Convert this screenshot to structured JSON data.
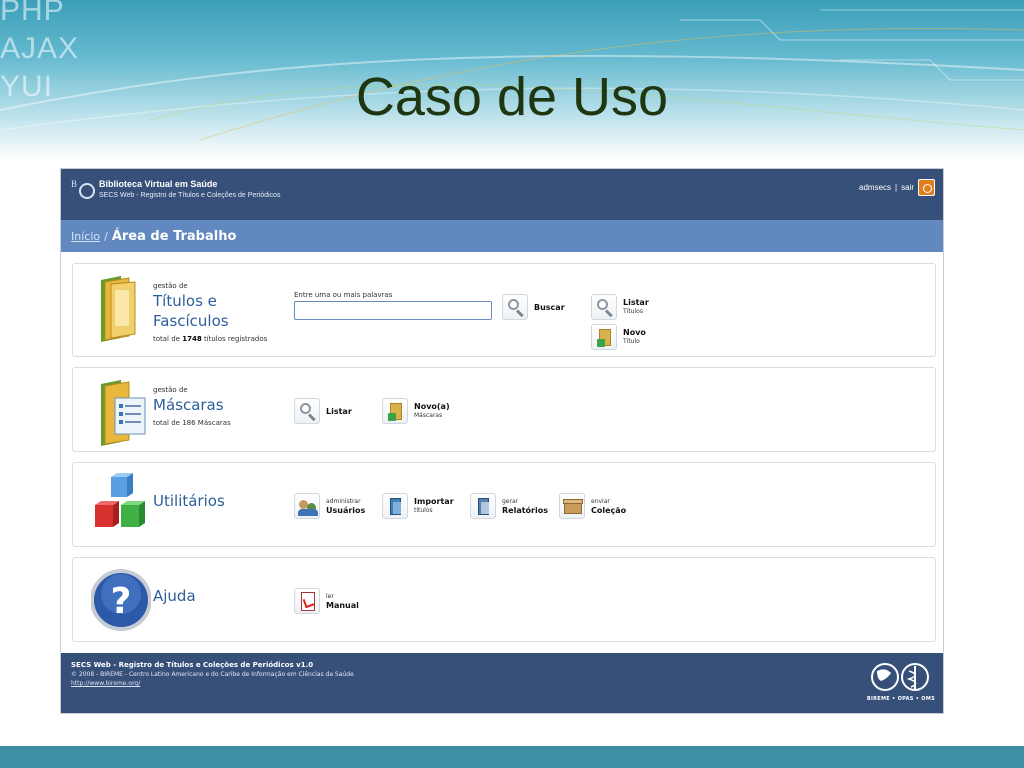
{
  "slide": {
    "side_words": [
      "PHP",
      "AJAX",
      "YUI"
    ],
    "title": "Caso de Uso"
  },
  "app": {
    "header": {
      "brand_name": "Biblioteca Virtual em Saúde",
      "brand_sub": "SECS Web - Registro de Títulos e Coleções de Periódicos",
      "user": "admsecs",
      "separator": "|",
      "logout": "sair"
    },
    "breadcrumb": {
      "home": "Início",
      "separator": "/",
      "current": "Área de Trabalho"
    },
    "titles_panel": {
      "pre_label": "gestão de",
      "title_line1": "Títulos e",
      "title_line2": "Fascículos",
      "total_prefix": "total de",
      "total_count": "1748",
      "total_suffix": "títulos registrados",
      "search_label": "Entre uma ou mais palavras",
      "search_value": "",
      "search_button": "Buscar",
      "list_main": "Listar",
      "list_small": "Títulos",
      "new_main": "Novo",
      "new_small": "Título"
    },
    "masks_panel": {
      "pre_label": "gestão de",
      "title": "Máscaras",
      "total": "total de 186 Máscaras",
      "list_label": "Listar",
      "new_main": "Novo(a)",
      "new_small": "Máscaras"
    },
    "utilities_panel": {
      "title": "Utilitários",
      "actions": [
        {
          "small": "administrar",
          "main": "Usuários"
        },
        {
          "small": "títulos",
          "main": "Importar"
        },
        {
          "small": "gerar",
          "main": "Relatórios"
        },
        {
          "small": "enviar",
          "main": "Coleção"
        }
      ]
    },
    "help_panel": {
      "title": "Ajuda",
      "manual_small": "ler",
      "manual_main": "Manual"
    },
    "footer": {
      "title": "SECS Web - Registro de Títulos e Coleções de Periódicos v1.0",
      "copyright": "© 2008 - BIREME - Centro Latino Americano e do Caribe de Informação em Ciências da Saúde",
      "link": "http://www.bireme.org/",
      "logos_text": "BIREME • OPAS • OMS"
    }
  },
  "colors": {
    "header_bg": "#37507a",
    "breadcrumb_bg": "#6188bf",
    "panel_title": "#2c5e99",
    "slide_title": "#1f3710"
  }
}
